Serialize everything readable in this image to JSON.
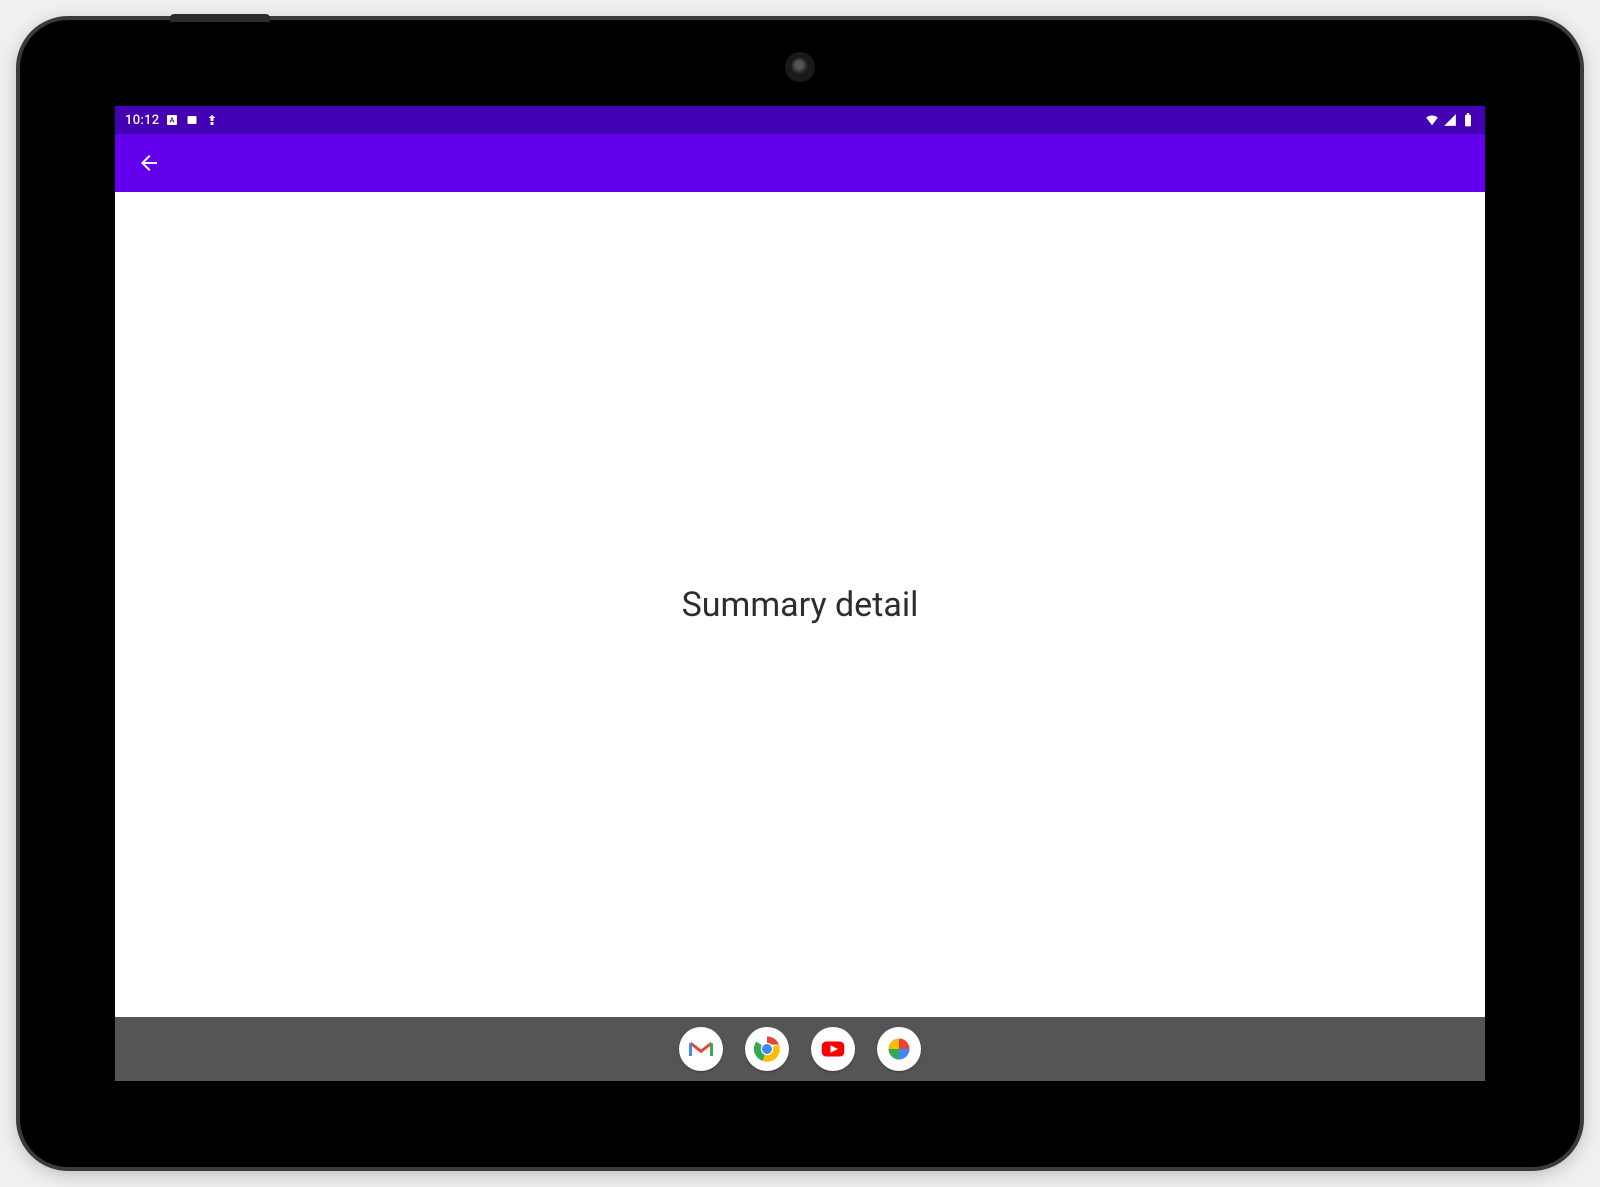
{
  "status_bar": {
    "time": "10:12",
    "icons_left": [
      "A",
      "card",
      "sync"
    ],
    "icons_right": [
      "wifi",
      "signal",
      "battery"
    ]
  },
  "app_bar": {
    "back_label": "Back"
  },
  "content": {
    "text": "Summary detail"
  },
  "dock": {
    "apps": [
      "Gmail",
      "Chrome",
      "YouTube",
      "Photos"
    ]
  },
  "colors": {
    "status_bar_bg": "#4400b3",
    "app_bar_bg": "#6200ee",
    "nav_bar_bg": "#555555"
  }
}
